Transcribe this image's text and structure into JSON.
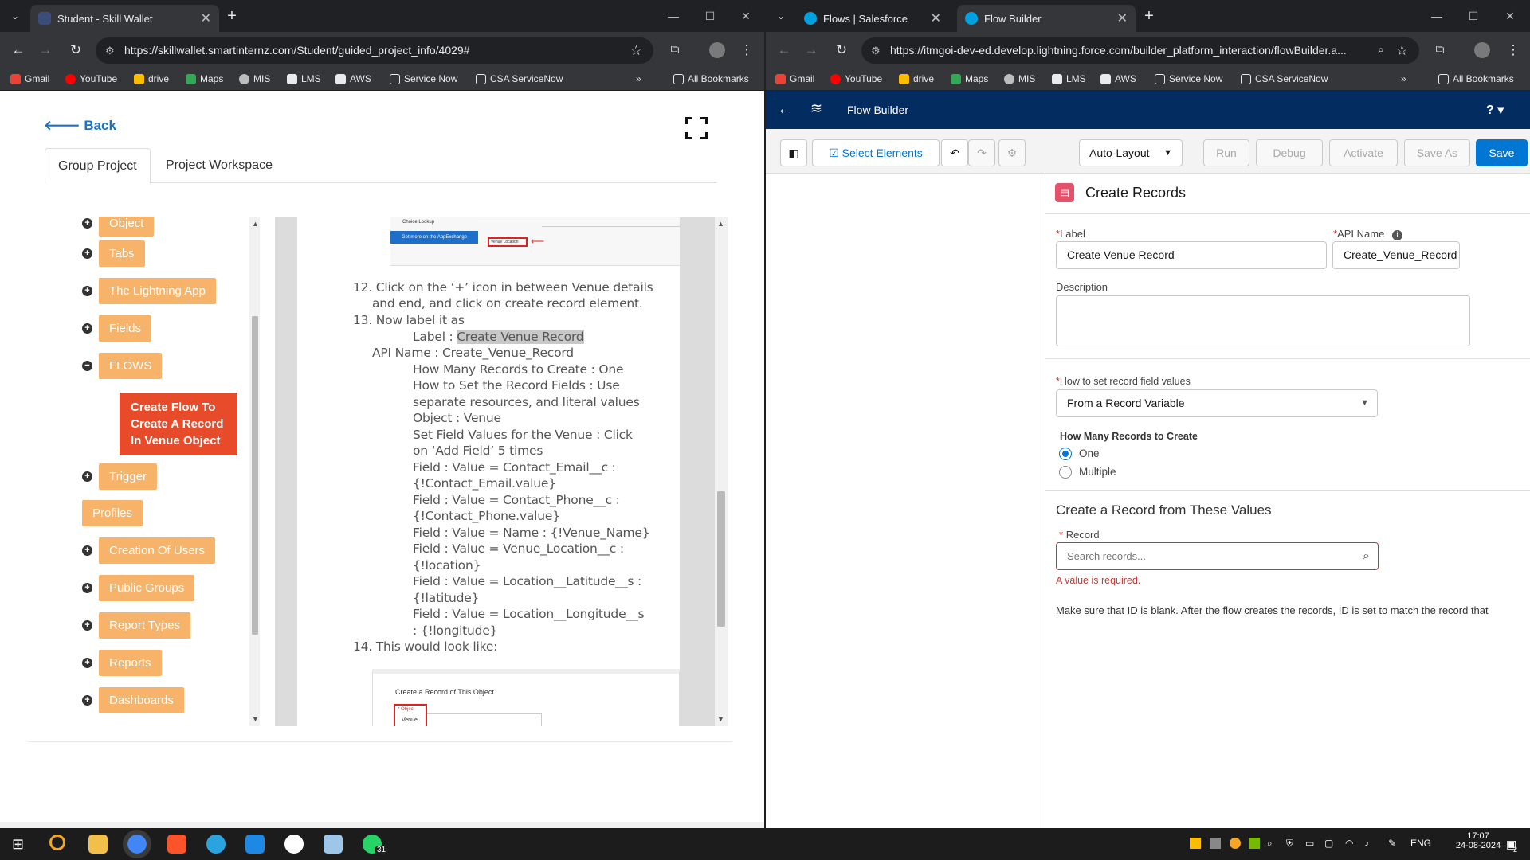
{
  "left": {
    "tab": {
      "title": "Student - Skill Wallet"
    },
    "url": "https://skillwallet.smartinternz.com/Student/guided_project_info/4029#",
    "bookmarks": [
      "Gmail",
      "YouTube",
      "drive",
      "Maps",
      "MIS",
      "LMS",
      "AWS",
      "Service Now",
      "CSA ServiceNow"
    ],
    "all_bookmarks": "All Bookmarks",
    "back": "Back",
    "tabs": [
      "Group Project",
      "Project Workspace"
    ],
    "sidebar": [
      "Object",
      "Tabs",
      "The Lightning App",
      "Fields",
      "FLOWS",
      "Create Flow To Create A Record In Venue Object",
      "Trigger",
      "Profiles",
      "Creation Of Users",
      "Public Groups",
      "Report Types",
      "Reports",
      "Dashboards"
    ],
    "doc": {
      "l12a": "12. Click on the ‘+’ icon in between Venue details",
      "l12b": "and end, and click on create record element.",
      "l13": "13. Now label it as",
      "label_pre": "Label : ",
      "label_hl": "Create Venue Record",
      "api": "API Name : Create_Venue_Record",
      "how_many": "How Many Records to Create : One",
      "howset1": "How to Set the Record Fields : Use",
      "howset2": "separate resources, and literal values",
      "object": "Object : Venue",
      "setf1": "Set Field Values for the Venue : Click",
      "setf2": "on ‘Add Field’ 5 times",
      "f1a": "Field : Value = Contact_Email__c :",
      "f1b": "{!Contact_Email.value}",
      "f2a": "Field : Value = Contact_Phone__c :",
      "f2b": "{!Contact_Phone.value}",
      "f3": "Field : Value = Name : {!Venue_Name}",
      "f4a": "Field : Value = Venue_Location__c :",
      "f4b": "{!location}",
      "f5a": "Field : Value = Location__Latitude__s :",
      "f5b": "{!latitude}",
      "f6a": "Field : Value = Location__Longitude__s",
      "f6b": ": {!longitude}",
      "l14": "14. This would look like:",
      "shot1_a": "Choice Lookup",
      "shot1_b": "Get more on the AppExchange",
      "shot1_c": "Venue Location",
      "shot2_title": "Create a Record of This Object",
      "shot2_obj": "* Object",
      "shot2_val": "Venue"
    }
  },
  "right": {
    "tabs": [
      "Flows | Salesforce",
      "Flow Builder"
    ],
    "url": "https://itmgoi-dev-ed.develop.lightning.force.com/builder_platform_interaction/flowBuilder.a...",
    "bookmarks": [
      "Gmail",
      "YouTube",
      "drive",
      "Maps",
      "MIS",
      "LMS",
      "AWS",
      "Service Now",
      "CSA ServiceNow"
    ],
    "all_bookmarks": "All Bookmarks",
    "app_title": "Flow Builder",
    "help": "?",
    "toolbar": {
      "select": "Select Elements",
      "layout": "Auto-Layout",
      "run": "Run",
      "debug": "Debug",
      "activate": "Activate",
      "save_as": "Save As",
      "save": "Save"
    },
    "panel": {
      "title": "Create Records",
      "label_lbl": "Label",
      "label_val": "Create Venue Record",
      "api_lbl": "API Name",
      "api_val": "Create_Venue_Record",
      "desc_lbl": "Description",
      "how_lbl": "How to set record field values",
      "how_val": "From a Record Variable",
      "many_lbl": "How Many Records to Create",
      "one": "One",
      "multiple": "Multiple",
      "section": "Create a Record from These Values",
      "record_lbl": "Record",
      "record_ph": "Search records...",
      "error": "A value is required.",
      "note": "Make sure that ID is blank. After the flow creates the records, ID is set to match the record that"
    }
  },
  "taskbar": {
    "lang": "ENG",
    "time": "17:07",
    "date": "24-08-2024",
    "badge": "31",
    "notif": "2"
  }
}
